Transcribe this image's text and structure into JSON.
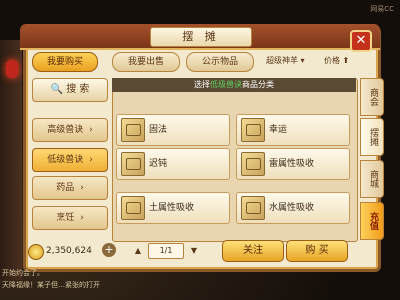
{
  "watermark": "网易CC",
  "window": {
    "title": "摆 摊"
  },
  "top_tabs": [
    "我要购买",
    "我要出售",
    "公示物品"
  ],
  "filters": {
    "select": "超级神羊",
    "sort": "价格 ⬆"
  },
  "left_panel": {
    "search": "搜 索",
    "categories": [
      "高级兽诀",
      "低级兽诀",
      "药品",
      "烹饪"
    ]
  },
  "list": {
    "header_prefix": "选择",
    "header_highlight": "低级兽诀",
    "header_suffix": "商品分类",
    "items": [
      "固法",
      "幸运",
      "迟钝",
      "雷属性吸收",
      "土属性吸收",
      "水属性吸收"
    ]
  },
  "side_tabs": [
    "商会",
    "摆摊",
    "商城",
    "充值"
  ],
  "bottom": {
    "money": "2,350,624",
    "page": "1/1",
    "follow": "关注",
    "buy": "购 买"
  },
  "chat": [
    "开始约会了。",
    "天降福缘！某子但…紧张的打开"
  ]
}
